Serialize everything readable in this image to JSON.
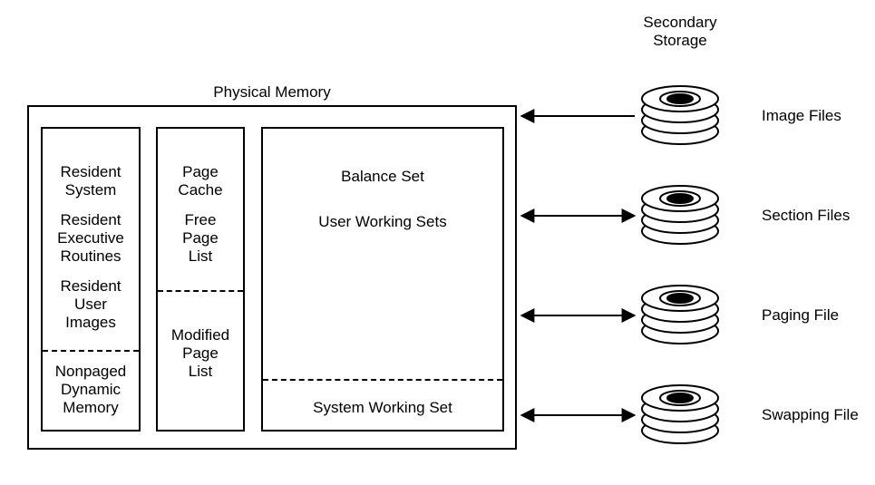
{
  "titles": {
    "physical_memory": "Physical Memory",
    "secondary_storage_l1": "Secondary",
    "secondary_storage_l2": "Storage"
  },
  "col1": {
    "resident_system_l1": "Resident",
    "resident_system_l2": "System",
    "resident_exec_l1": "Resident",
    "resident_exec_l2": "Executive",
    "resident_exec_l3": "Routines",
    "resident_user_l1": "Resident",
    "resident_user_l2": "User",
    "resident_user_l3": "Images",
    "nonpaged_l1": "Nonpaged",
    "nonpaged_l2": "Dynamic",
    "nonpaged_l3": "Memory"
  },
  "col2": {
    "page_cache_l1": "Page",
    "page_cache_l2": "Cache",
    "free_page_l1": "Free",
    "free_page_l2": "Page",
    "free_page_l3": "List",
    "modified_l1": "Modified",
    "modified_l2": "Page",
    "modified_l3": "List"
  },
  "col3": {
    "balance_set": "Balance Set",
    "user_ws": "User Working Sets",
    "system_ws": "System Working Set"
  },
  "disks": {
    "image_files": "Image Files",
    "section_files": "Section Files",
    "paging_file": "Paging File",
    "swapping_file": "Swapping File"
  }
}
